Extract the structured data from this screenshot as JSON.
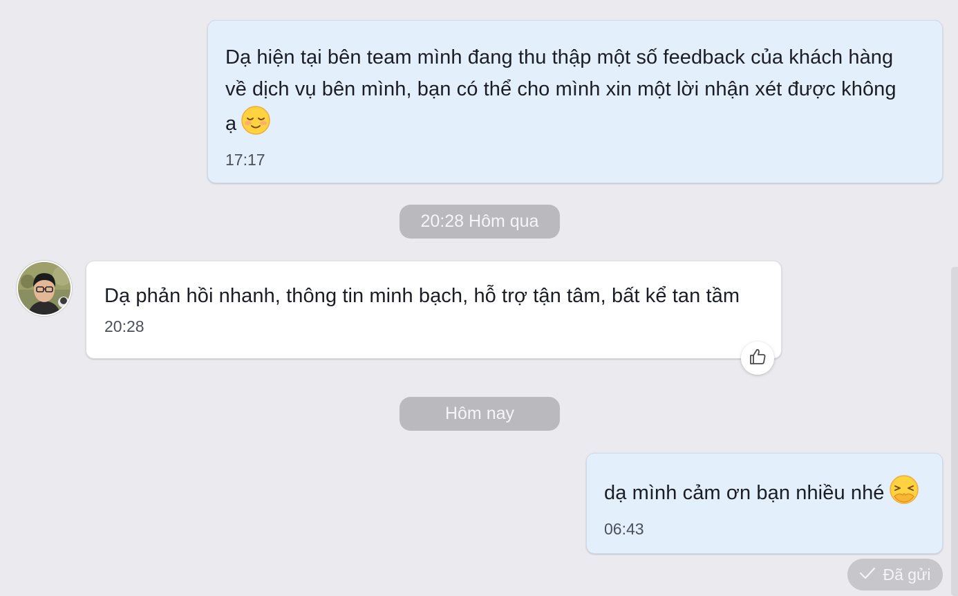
{
  "messages": [
    {
      "direction": "outgoing",
      "text_line1": "Dạ hiện tại bên team mình đang thu thập một số feedback của khách hàng",
      "text_line2": "về dịch vụ bên mình, bạn có thể cho mình xin một lời nhận xét được không",
      "text_line3": "ạ",
      "emoji": "smiling-face-with-closed-eyes",
      "time": "17:17"
    },
    {
      "direction": "incoming",
      "text": "Dạ phản hồi nhanh, thông tin minh bạch, hỗ trợ tận tâm, bất kể tan tầm",
      "time": "20:28",
      "reaction": "thumbs-up"
    },
    {
      "direction": "outgoing",
      "text": "dạ mình cảm ơn bạn nhiều nhé",
      "emoji": "face-with-hand-over-mouth",
      "time": "06:43"
    }
  ],
  "date_dividers": [
    "20:28 Hôm qua",
    "Hôm nay"
  ],
  "status": {
    "label": "Đã gửi",
    "icon": "checkmark-icon"
  },
  "colors": {
    "background": "#ebebef",
    "outgoing_bubble": "#e4effc",
    "incoming_bubble": "#ffffff",
    "pill": "#b9b9be"
  }
}
